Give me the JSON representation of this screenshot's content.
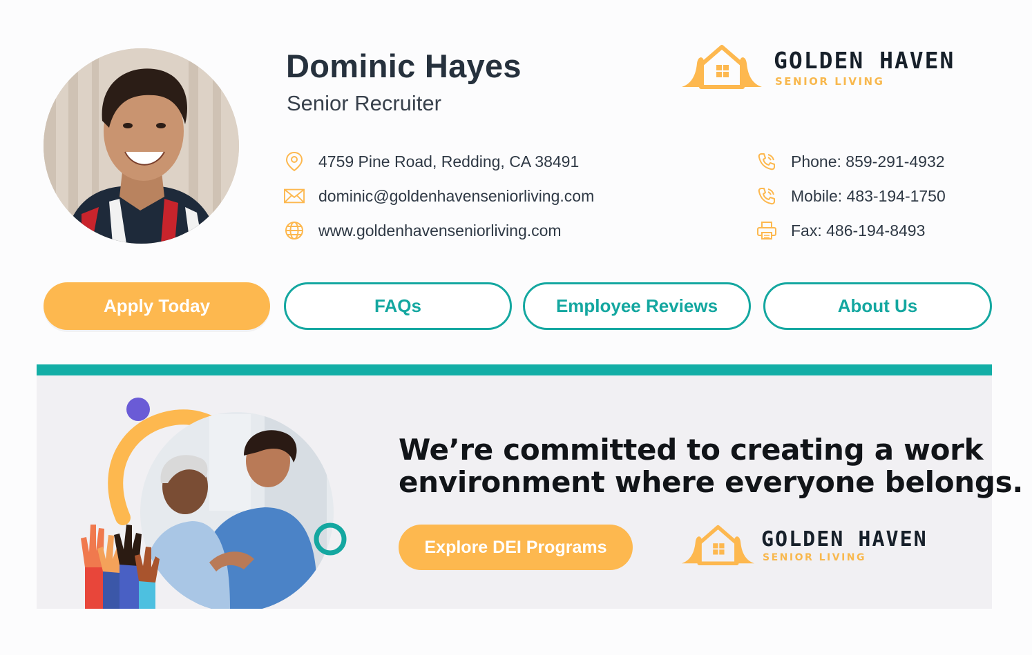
{
  "profile": {
    "name": "Dominic Hayes",
    "title": "Senior Recruiter"
  },
  "brand": {
    "name": "GOLDEN HAVEN",
    "tagline": "SENIOR LIVING",
    "accent_color": "#fdb84f",
    "teal_color": "#14a7a0"
  },
  "contact_left": [
    {
      "icon": "location-pin-icon",
      "text": "4759 Pine Road, Redding, CA 38491"
    },
    {
      "icon": "mail-icon",
      "text": "dominic@goldenhavenseniorliving.com"
    },
    {
      "icon": "globe-icon",
      "text": "www.goldenhavenseniorliving.com"
    }
  ],
  "contact_right": [
    {
      "icon": "phone-icon",
      "text": "Phone: 859-291-4932"
    },
    {
      "icon": "phone-icon",
      "text": "Mobile: 483-194-1750"
    },
    {
      "icon": "printer-icon",
      "text": "Fax: 486-194-8493"
    }
  ],
  "buttons": {
    "apply": "Apply Today",
    "faqs": "FAQs",
    "reviews": "Employee Reviews",
    "about": "About Us"
  },
  "banner": {
    "headline_line1": "We’re committed to creating a work",
    "headline_line2": "environment where everyone belongs.",
    "cta": "Explore DEI Programs"
  }
}
